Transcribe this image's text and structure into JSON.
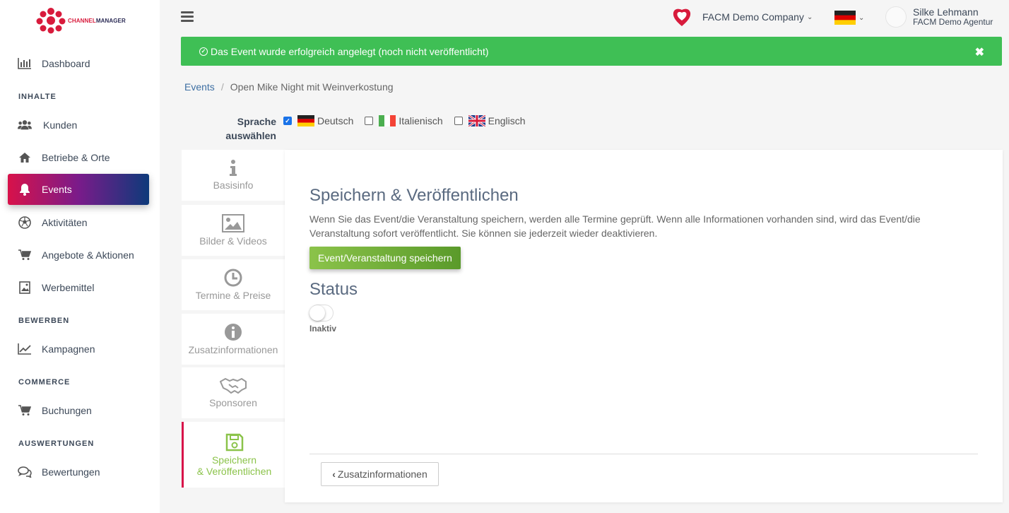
{
  "brand": {
    "logo_channel": "CHANNEL",
    "logo_manager": "MANAGER"
  },
  "sidebar": {
    "items": [
      {
        "label": "Dashboard",
        "icon": "bar-chart-icon"
      },
      {
        "label": "Kunden",
        "icon": "users-icon"
      },
      {
        "label": "Betriebe & Orte",
        "icon": "home-icon"
      },
      {
        "label": "Events",
        "icon": "bell-icon",
        "active": true
      },
      {
        "label": "Aktivitäten",
        "icon": "soccer-ball-icon"
      },
      {
        "label": "Angebote & Aktionen",
        "icon": "cart-icon"
      },
      {
        "label": "Werbemittel",
        "icon": "image-icon"
      },
      {
        "label": "Kampagnen",
        "icon": "line-chart-icon"
      },
      {
        "label": "Buchungen",
        "icon": "cart-icon"
      },
      {
        "label": "Bewertungen",
        "icon": "comments-icon"
      }
    ],
    "sections": {
      "inhalte": "INHALTE",
      "bewerben": "BEWERBEN",
      "commerce": "COMMERCE",
      "auswertungen": "AUSWERTUNGEN"
    }
  },
  "topbar": {
    "company": "FACM Demo Company",
    "user_name": "Silke Lehmann",
    "user_agency": "FACM Demo Agentur"
  },
  "alert": {
    "message": "Das Event wurde erfolgreich angelegt (noch nicht veröffentlicht)",
    "close": "✖"
  },
  "breadcrumb": {
    "root": "Events",
    "separator": "/",
    "current": "Open Mike Night mit Weinverkostung"
  },
  "language": {
    "label_line1": "Sprache",
    "label_line2": "auswählen",
    "options": [
      {
        "label": "Deutsch",
        "checked": true
      },
      {
        "label": "Italienisch",
        "checked": false
      },
      {
        "label": "Englisch",
        "checked": false
      }
    ]
  },
  "tabs": [
    {
      "label": "Basisinfo",
      "icon": "info-icon"
    },
    {
      "label": "Bilder & Videos",
      "icon": "picture-icon"
    },
    {
      "label": "Termine & Preise",
      "icon": "clock-icon"
    },
    {
      "label": "Zusatzinformationen",
      "icon": "info-circle-icon"
    },
    {
      "label": "Sponsoren",
      "icon": "handshake-icon"
    },
    {
      "label_line1": "Speichern",
      "label_line2": "& Veröffentlichen",
      "icon": "floppy-disk-icon",
      "active": true
    }
  ],
  "main": {
    "title": "Speichern & Veröffentlichen",
    "description": "Wenn Sie das Event/die Veranstaltung speichern, werden alle Termine geprüft. Wenn alle Informationen vorhanden sind, wird das Event/die Veranstaltung sofort veröffentlicht. Sie können sie jederzeit wieder deaktivieren.",
    "save_button": "Event/Veranstaltung speichern",
    "status_title": "Status",
    "status_value": "Inaktiv",
    "back_button": "Zusatzinformationen"
  },
  "colors": {
    "accent_green": "#8bc34a",
    "alert_green": "#3fbf55",
    "active_gradient_start": "#d8124a",
    "active_gradient_end": "#0d3a7a",
    "link_blue": "#3e6fa3"
  }
}
